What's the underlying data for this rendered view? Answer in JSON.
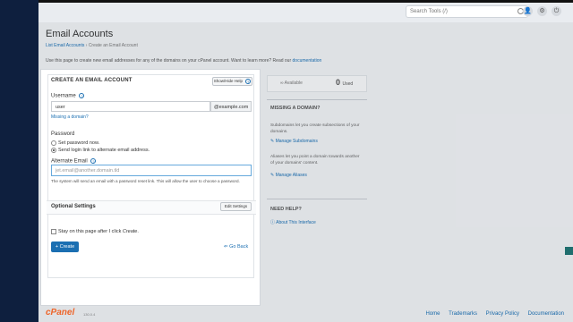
{
  "header": {
    "search_placeholder": "Search Tools (/)",
    "user_icon_glyph": "👤",
    "gear_icon_glyph": "⚙",
    "power_icon_glyph": "⏻"
  },
  "page": {
    "title": "Email Accounts",
    "breadcrumb_link": "List Email Accounts",
    "breadcrumb_sep": "›",
    "breadcrumb_current": "Create an Email Account",
    "intro_text": "Use this page to create new email addresses for any of the domains on your cPanel account. Want to learn more? Read our",
    "intro_link": "documentation"
  },
  "form": {
    "card_title": "CREATE AN EMAIL ACCOUNT",
    "help_button": "Show/Hide Help",
    "username_label": "Username",
    "username_value": "user",
    "domain_value": "@example.com",
    "missing_domain_link": "Missing a domain?",
    "password_label": "Password",
    "option_set_password": "Set password now.",
    "option_send_link": "Send login link to alternate email address.",
    "selected_option": "send_link",
    "alternate_email_label": "Alternate Email",
    "alternate_email_placeholder": "jet.email@another.domain.tld",
    "note_text": "The system will send an email with a password reset link. This will allow the user to choose a password.",
    "optional_settings_label": "Optional Settings",
    "edit_settings_button": "Edit Settings",
    "stay_label_prefix": "Stay on this page after I click",
    "stay_label_em": "Create",
    "stay_label_suffix": ".",
    "create_button": "+ Create",
    "go_back_link": "⇐ Go Back"
  },
  "sidebar_right": {
    "stat_available": "∞ Available",
    "stat_used_value": "0",
    "stat_used_label": "Used",
    "missing_domain_heading": "MISSING A DOMAIN?",
    "subdomains_text": "Subdomains let you create subsections of your domains.",
    "manage_subdomains_link": "✎ Manage Subdomains",
    "aliases_text": "Aliases let you point a domain towards another of your domains' content.",
    "manage_aliases_link": "✎ Manage Aliases",
    "need_help_heading": "NEED HELP?",
    "about_link": "ⓘ About This Interface"
  },
  "footer": {
    "logo": "cPanel",
    "version": "130.0.4",
    "links": [
      "Home",
      "Trademarks",
      "Privacy Policy",
      "Documentation"
    ]
  },
  "colors": {
    "accent": "#1b6fb2",
    "sidebar": "#0e1f3e",
    "brand_orange": "#ff6c2c"
  }
}
